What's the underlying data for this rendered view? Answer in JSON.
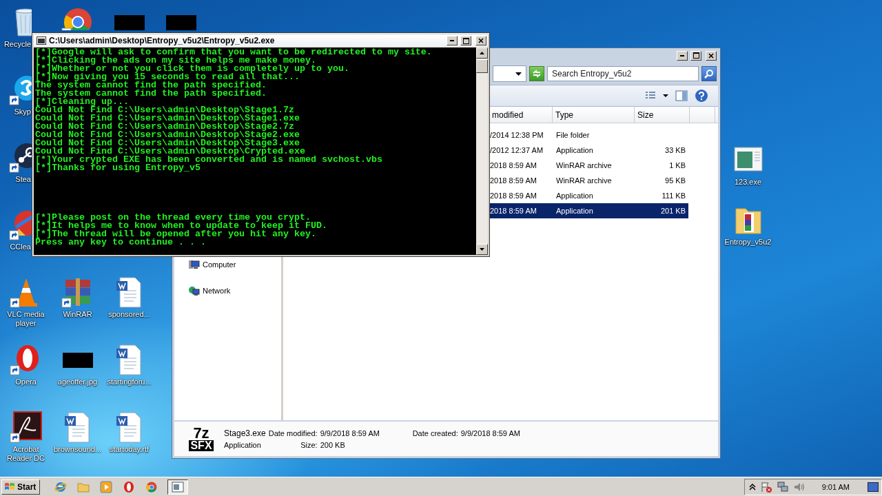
{
  "desktop": {
    "icon_rows": [
      [
        {
          "kind": "recycle-bin",
          "label": "Recycle",
          "shortcut": false
        },
        {
          "kind": "browser",
          "shortcut": true
        },
        {
          "kind": "dark-thumbnail",
          "shortcut": false
        },
        {
          "kind": "dark-thumbnail",
          "shortcut": false
        }
      ],
      [
        {
          "kind": "chat",
          "label": "Skyp",
          "shortcut": true
        }
      ],
      [
        {
          "kind": "game-client",
          "label": "Stea",
          "shortcut": true
        }
      ],
      [
        {
          "kind": "cleaner",
          "label": "CClea",
          "shortcut": true
        }
      ],
      [
        {
          "kind": "cone",
          "label": "VLC media player",
          "shortcut": true
        },
        {
          "kind": "archive-books",
          "label": "WinRAR",
          "shortcut": true
        },
        {
          "kind": "document",
          "label": "sponsored...",
          "shortcut": false
        }
      ],
      [
        {
          "kind": "ring",
          "label": "Opera",
          "shortcut": true
        },
        {
          "kind": "dark-thumbnail",
          "label": "ageoffer.jpg",
          "shortcut": false
        },
        {
          "kind": "document",
          "label": "startingforu...",
          "shortcut": false
        }
      ],
      [
        {
          "kind": "pdf-reader",
          "label": "Acrobat Reader DC",
          "shortcut": true
        },
        {
          "kind": "document",
          "label": "brownsound...",
          "shortcut": false
        },
        {
          "kind": "document",
          "label": "startoday.rtf",
          "shortcut": false
        }
      ]
    ],
    "right_icons": [
      {
        "kind": "program-window",
        "label": "123.exe",
        "shortcut": false
      },
      {
        "kind": "archive-folder",
        "label": "Entropy_v5u2",
        "shortcut": false
      }
    ]
  },
  "explorer": {
    "search": {
      "placeholder": "Search Entropy_v5u2"
    },
    "columns": [
      "modified",
      "Type",
      "Size"
    ],
    "rows": [
      {
        "modified": "/2014 12:38 PM",
        "type": "File folder",
        "selected": false
      },
      {
        "modified": "/2012 12:37 AM",
        "type": "Application",
        "size": "33 KB",
        "selected": false
      },
      {
        "modified": "2018 8:59 AM",
        "type": "WinRAR archive",
        "size": "1 KB",
        "selected": false
      },
      {
        "modified": "2018 8:59 AM",
        "type": "WinRAR archive",
        "size": "95 KB",
        "selected": false
      },
      {
        "modified": "2018 8:59 AM",
        "type": "Application",
        "size": "111 KB",
        "selected": false
      },
      {
        "modified": "2018 8:59 AM",
        "type": "Application",
        "size": "201 KB",
        "selected": true
      }
    ],
    "nav_items": [
      {
        "kind": "computer",
        "label": "Computer"
      },
      {
        "kind": "network",
        "label": "Network"
      }
    ],
    "details": {
      "icon_text": [
        "7z",
        "SFX"
      ],
      "name": "Stage3.exe",
      "type": "Application",
      "date_modified": {
        "label": "Date modified:",
        "value": "9/9/2018 8:59 AM"
      },
      "date_created": {
        "label": "Date created:",
        "value": "9/9/2018 8:59 AM"
      },
      "size": {
        "label": "Size:",
        "value": "200 KB"
      }
    }
  },
  "console": {
    "title": "C:\\Users\\admin\\Desktop\\Entropy_v5u2\\Entropy_v5u2.exe",
    "lines": [
      "[*]Google will ask to confirm that you want to be redirected to my site.",
      "[*]Clicking the ads on my site helps me make money.",
      "[*]Whether or not you click them is completely up to you.",
      "[*]Now giving you 15 seconds to read all that...",
      "The system cannot find the path specified.",
      "The system cannot find the path specified.",
      "[*]Cleaning up...",
      "Could Not Find C:\\Users\\admin\\Desktop\\Stage1.7z",
      "Could Not Find C:\\Users\\admin\\Desktop\\Stage1.exe",
      "Could Not Find C:\\Users\\admin\\Desktop\\Stage2.7z",
      "Could Not Find C:\\Users\\admin\\Desktop\\Stage2.exe",
      "Could Not Find C:\\Users\\admin\\Desktop\\Stage3.exe",
      "Could Not Find C:\\Users\\admin\\Desktop\\Crypted.exe",
      "[*]Your crypted EXE has been converted and is named svchost.vbs",
      "[*]Thanks for using Entropy_v5"
    ],
    "lines_after_gap": [
      "[*]Please post on the thread every time you crypt.",
      "[*]It helps me to know when to update to keep it FUD.",
      "[*]The thread will be opened after you hit any key.",
      "Press any key to continue . . ."
    ]
  },
  "taskbar": {
    "start": "Start",
    "buttons": [
      {
        "kind": "ie",
        "selected": false
      },
      {
        "kind": "folder",
        "selected": false
      },
      {
        "kind": "media",
        "selected": false
      },
      {
        "kind": "ring",
        "selected": false
      },
      {
        "kind": "browser",
        "selected": false
      },
      {
        "kind": "console",
        "selected": true
      }
    ],
    "tray": {
      "time": "9:01 AM"
    }
  }
}
